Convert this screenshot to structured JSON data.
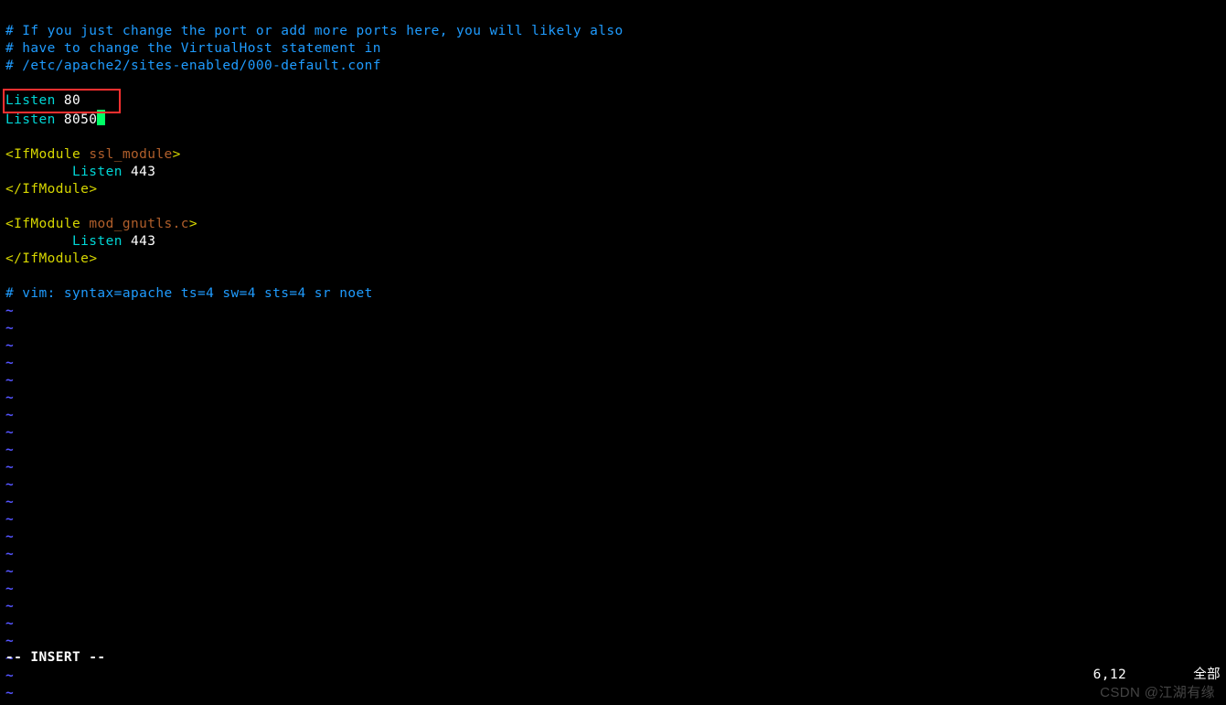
{
  "comments": {
    "c1": "# If you just change the port or add more ports here, you will likely also",
    "c2": "# have to change the VirtualHost statement in",
    "c3": "# /etc/apache2/sites-enabled/000-default.conf",
    "vimline": "# vim: syntax=apache ts=4 sw=4 sts=4 sr noet"
  },
  "directives": {
    "listen1_kw": "Listen",
    "listen1_port": " 80",
    "listen2_kw": "Listen",
    "listen2_port": " 8050",
    "ssl_open_tag_l": "<",
    "ssl_open_tag_name": "IfModule",
    "ssl_open_attr": " ssl_module",
    "ssl_open_tag_r": ">",
    "ssl_indent": "        ",
    "ssl_listen_kw": "Listen",
    "ssl_listen_port": " 443",
    "ssl_close": "</",
    "ssl_close_name": "IfModule",
    "ssl_close_r": ">",
    "gnutls_open_tag_l": "<",
    "gnutls_open_tag_name": "IfModule",
    "gnutls_open_attr": " mod_gnutls.c",
    "gnutls_open_tag_r": ">",
    "gnutls_indent": "        ",
    "gnutls_listen_kw": "Listen",
    "gnutls_listen_port": " 443",
    "gnutls_close": "</",
    "gnutls_close_name": "IfModule",
    "gnutls_close_r": ">"
  },
  "tilde": "~",
  "status": {
    "mode": "-- INSERT --",
    "pos": "6,12",
    "scroll": "全部"
  },
  "watermark": "CSDN @江湖有缘"
}
